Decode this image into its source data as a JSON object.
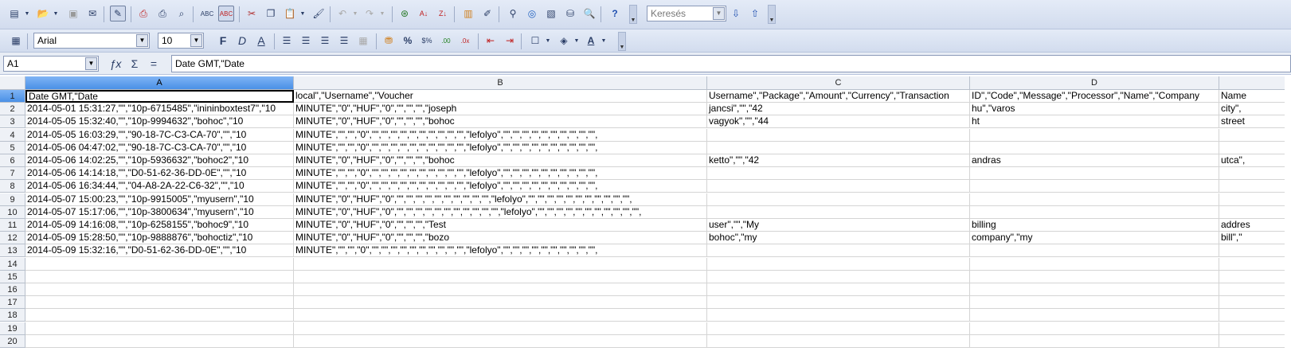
{
  "toolbar1": {
    "search_placeholder": "Keresés",
    "icons": [
      "new-icon",
      "open-icon",
      "save-icon",
      "email-icon",
      "edit-mode-icon",
      "pdf-icon",
      "print-icon",
      "print-preview-icon",
      "spellcheck-icon",
      "autospellcheck-icon",
      "cut-icon",
      "copy-icon",
      "paste-icon",
      "format-paintbrush-icon",
      "undo-icon",
      "redo-icon",
      "hyperlink-icon",
      "sort-ascending-icon",
      "sort-descending-icon",
      "chart-icon",
      "draw-functions-icon",
      "find-replace-icon",
      "navigator-icon",
      "gallery-icon",
      "data-sources-icon",
      "zoom-icon",
      "help-icon",
      "find-next-icon",
      "find-previous-icon"
    ]
  },
  "toolbar2": {
    "font_name": "Arial",
    "font_size": "10",
    "bold": "F",
    "italic": "D",
    "underline": "A"
  },
  "formula_bar": {
    "cell_ref": "A1",
    "content": "Date GMT,\"Date"
  },
  "sheet": {
    "columns": [
      "A",
      "B",
      "C",
      "D"
    ],
    "rows": [
      {
        "n": "1",
        "a": "Date GMT,\"Date",
        "b": "local\",\"Username\",\"Voucher",
        "c": "Username\",\"Package\",\"Amount\",\"Currency\",\"Transaction",
        "d": "ID\",\"Code\",\"Message\",\"Processor\",\"Name\",\"Company",
        "e": "Name"
      },
      {
        "n": "2",
        "a": "2014-05-01 15:31:27,\"\",\"10p-6715485\",\"inininboxtest7\",\"10",
        "b": "MINUTE\",\"0\",\"HUF\",\"0\",\"\",\"\",\"\",\"joseph",
        "c": "jancsi\",\"\",\"42",
        "d": "hu\",\"varos",
        "e": "city\","
      },
      {
        "n": "3",
        "a": "2014-05-05 15:32:40,\"\",\"10p-9994632\",\"bohoc\",\"10",
        "b": "MINUTE\",\"0\",\"HUF\",\"0\",\"\",\"\",\"\",\"bohoc",
        "c": "vagyok\",\"\",\"44",
        "d": "ht",
        "e": "street"
      },
      {
        "n": "4",
        "a": "2014-05-05 16:03:29,\"\",\"90-18-7C-C3-CA-70\",\"\",\"10",
        "b": "MINUTE\",\"\",\"\",\"0\",\"\",\"\",\"\",\"\",\"\",\"\",\"\",\"\",\"\",\"\",\"lefolyo\",\"\",\"\",\"\",\"\",\"\",\"\",\"\",\"\",\"\",\"\",",
        "c": "",
        "d": "",
        "e": ""
      },
      {
        "n": "5",
        "a": "2014-05-06 04:47:02,\"\",\"90-18-7C-C3-CA-70\",\"\",\"10",
        "b": "MINUTE\",\"\",\"\",\"0\",\"\",\"\",\"\",\"\",\"\",\"\",\"\",\"\",\"\",\"\",\"lefolyo\",\"\",\"\",\"\",\"\",\"\",\"\",\"\",\"\",\"\",\"\",",
        "c": "",
        "d": "",
        "e": ""
      },
      {
        "n": "6",
        "a": "2014-05-06 14:02:25,\"\",\"10p-5936632\",\"bohoc2\",\"10",
        "b": "MINUTE\",\"0\",\"HUF\",\"0\",\"\",\"\",\"\",\"bohoc",
        "c": "ketto\",\"\",\"42",
        "d": "andras",
        "e": "utca\","
      },
      {
        "n": "7",
        "a": "2014-05-06 14:14:18,\"\",\"D0-51-62-36-DD-0E\",\"\",\"10",
        "b": "MINUTE\",\"\",\"\",\"0\",\"\",\"\",\"\",\"\",\"\",\"\",\"\",\"\",\"\",\"\",\"lefolyo\",\"\",\"\",\"\",\"\",\"\",\"\",\"\",\"\",\"\",\"\",",
        "c": "",
        "d": "",
        "e": ""
      },
      {
        "n": "8",
        "a": "2014-05-06 16:34:44,\"\",\"04-A8-2A-22-C6-32\",\"\",\"10",
        "b": "MINUTE\",\"\",\"\",\"0\",\"\",\"\",\"\",\"\",\"\",\"\",\"\",\"\",\"\",\"\",\"lefolyo\",\"\",\"\",\"\",\"\",\"\",\"\",\"\",\"\",\"\",\"\",",
        "c": "",
        "d": "",
        "e": ""
      },
      {
        "n": "9",
        "a": "2014-05-07 15:00:23,\"\",\"10p-9915005\",\"myusern\",\"10",
        "b": "MINUTE\",\"0\",\"HUF\",\"0\",\"\",\"\",\"\",\"\",\"\",\"\",\"\",\"\",\"\",\"\",\"lefolyo\",\"\",\"\",\"\",\"\",\"\",\"\",\"\",\"\",\"\",\"\",\"\",",
        "c": "",
        "d": "",
        "e": ""
      },
      {
        "n": "10",
        "a": "2014-05-07 15:17:06,\"\",\"10p-3800634\",\"myusern\",\"10",
        "b": "MINUTE\",\"0\",\"HUF\",\"0\",\"\",\"\",\"\",\"\",\"\",\"\",\"\",\"\",\"\",\"\",\"\",\"lefolyo\",\"\",\"\",\"\",\"\",\"\",\"\",\"\",\"\",\"\",\"\",\"\",",
        "c": "",
        "d": "",
        "e": ""
      },
      {
        "n": "11",
        "a": "2014-05-09 14:16:08,\"\",\"10p-6258155\",\"bohoc9\",\"10",
        "b": "MINUTE\",\"0\",\"HUF\",\"0\",\"\",\"\",\"\",\"Test",
        "c": "user\",\"\",\"My",
        "d": "billing",
        "e": "addres"
      },
      {
        "n": "12",
        "a": "2014-05-09 15:28:50,\"\",\"10p-9888876\",\"bohoctiz\",\"10",
        "b": "MINUTE\",\"0\",\"HUF\",\"0\",\"\",\"\",\"\",\"bozo",
        "c": "bohoc\",\"my",
        "d": "company\",\"my",
        "e": "bill\",\""
      },
      {
        "n": "13",
        "a": "2014-05-09 15:32:16,\"\",\"D0-51-62-36-DD-0E\",\"\",\"10",
        "b": "MINUTE\",\"\",\"\",\"0\",\"\",\"\",\"\",\"\",\"\",\"\",\"\",\"\",\"\",\"\",\"lefolyo\",\"\",\"\",\"\",\"\",\"\",\"\",\"\",\"\",\"\",\"\",",
        "c": "",
        "d": "",
        "e": ""
      },
      {
        "n": "14",
        "a": "",
        "b": "",
        "c": "",
        "d": "",
        "e": ""
      },
      {
        "n": "15",
        "a": "",
        "b": "",
        "c": "",
        "d": "",
        "e": ""
      },
      {
        "n": "16",
        "a": "",
        "b": "",
        "c": "",
        "d": "",
        "e": ""
      },
      {
        "n": "17",
        "a": "",
        "b": "",
        "c": "",
        "d": "",
        "e": ""
      },
      {
        "n": "18",
        "a": "",
        "b": "",
        "c": "",
        "d": "",
        "e": ""
      },
      {
        "n": "19",
        "a": "",
        "b": "",
        "c": "",
        "d": "",
        "e": ""
      },
      {
        "n": "20",
        "a": "",
        "b": "",
        "c": "",
        "d": "",
        "e": ""
      }
    ]
  }
}
